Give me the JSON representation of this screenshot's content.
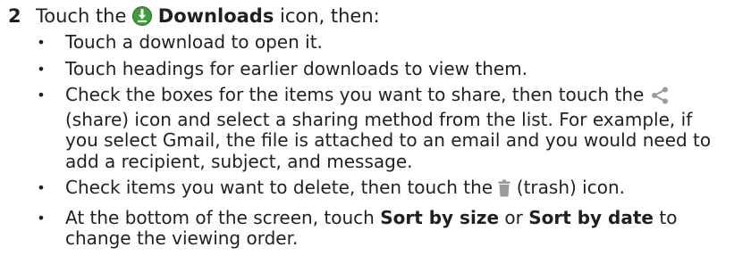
{
  "step": {
    "number": "2",
    "intro_prefix": "Touch the ",
    "intro_bold": "Downloads",
    "intro_suffix": " icon, then:",
    "icon": "downloads-icon"
  },
  "bullets": [
    {
      "text": "Touch a download to open it."
    },
    {
      "text": "Touch headings for earlier downloads to view them."
    },
    {
      "part1": "Check the boxes for the items you want to share, then touch the ",
      "icon": "share-icon",
      "part2": " (share) icon and select a sharing method from the list. For example, if you select Gmail, the file is attached to an email and you would need to add a recipient, subject, and message."
    },
    {
      "part1": "Check items you want to delete, then touch the ",
      "icon": "trash-icon",
      "part2": " (trash) icon."
    },
    {
      "part1": "At the bottom of the screen, touch ",
      "bold1": "Sort by size",
      "part2": " or ",
      "bold2": "Sort by date",
      "part3": " to change the viewing order."
    }
  ],
  "colors": {
    "text": "#231f20",
    "downloads_icon_green": "#3f9b3c",
    "icon_gray": "#9a9a9a"
  }
}
